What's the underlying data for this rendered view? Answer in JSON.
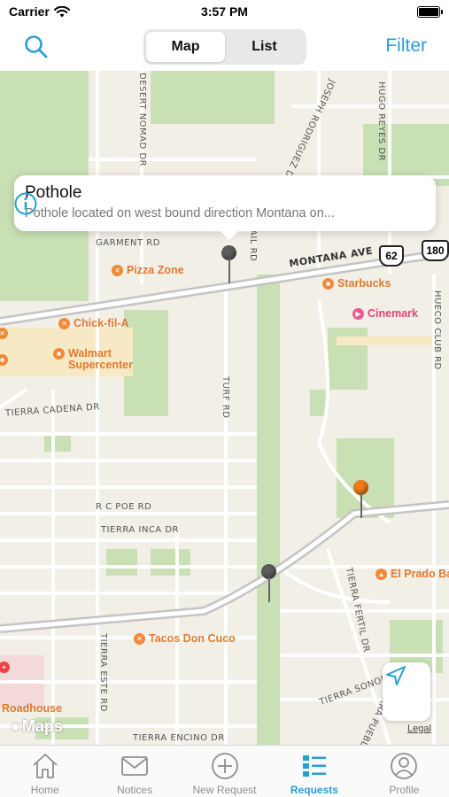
{
  "status_bar": {
    "carrier": "Carrier",
    "time": "3:57 PM"
  },
  "nav": {
    "segments": [
      "Map",
      "List"
    ],
    "selected_segment": "Map",
    "filter_label": "Filter"
  },
  "map": {
    "callout": {
      "title": "Pothole",
      "subtitle": "Pothole located on west bound direction Montana on..."
    },
    "pois": [
      {
        "name": "Pizza Zone",
        "icon": "fork-knife-icon"
      },
      {
        "name": "Starbucks",
        "icon": "cup-icon"
      },
      {
        "name": "Chick-fil-A",
        "icon": "fork-knife-icon"
      },
      {
        "name": "Cinemark",
        "icon": "film-icon"
      },
      {
        "name": "Walmart",
        "icon": "bag-icon"
      },
      {
        "name": "Supercenter",
        "icon": "bag-icon"
      },
      {
        "name": "El Prado Ba",
        "icon": "home-icon"
      },
      {
        "name": "Tacos Don Cuco",
        "icon": "fork-knife-icon"
      },
      {
        "name": "Roadhouse",
        "icon": "fork-knife-icon"
      }
    ],
    "streets": {
      "garment": "GARMENT RD",
      "montana": "MONTANA AVE",
      "tierra_cadena": "TIERRA CADENA DR",
      "rc_poe": "R C POE RD",
      "tierra_inca": "TIERRA INCA DR",
      "tierra_sonora": "TIERRA SONORA DR",
      "tierra_encino": "TIERRA ENCINO DR",
      "desert_nomad": "DESERT NOMAD DR",
      "joseph_rodriguez": "JOSEPH RODRIGUEZ DR",
      "hugo_reyes": "HUGO REYES DR",
      "hueco_club": "HUECO CLUB RD",
      "turf": "TURF RD",
      "rail": "RAIL RD",
      "tierra_fertil": "TIERRA FERTIL DR",
      "tierra_este": "TIERRA ESTE RD",
      "tierra_pueblo": "TIERRA PUEBLO DR"
    },
    "shields": [
      "62",
      "180"
    ],
    "maps_label": "Maps",
    "legal_label": "Legal",
    "colors": {
      "pin_selected": "#5c5c5c",
      "pin_default": "#5c5c5c",
      "pin_accent": "#f07a1a",
      "road_major": "#b8b8b8",
      "park": "#c6dfb1"
    }
  },
  "tabs": [
    {
      "label": "Home",
      "icon": "home-icon"
    },
    {
      "label": "Notices",
      "icon": "envelope-icon"
    },
    {
      "label": "New Request",
      "icon": "plus-circle-icon"
    },
    {
      "label": "Requests",
      "icon": "list-icon"
    },
    {
      "label": "Profile",
      "icon": "person-icon"
    }
  ],
  "active_tab": "Requests",
  "accent_color": "#2a9fd6"
}
